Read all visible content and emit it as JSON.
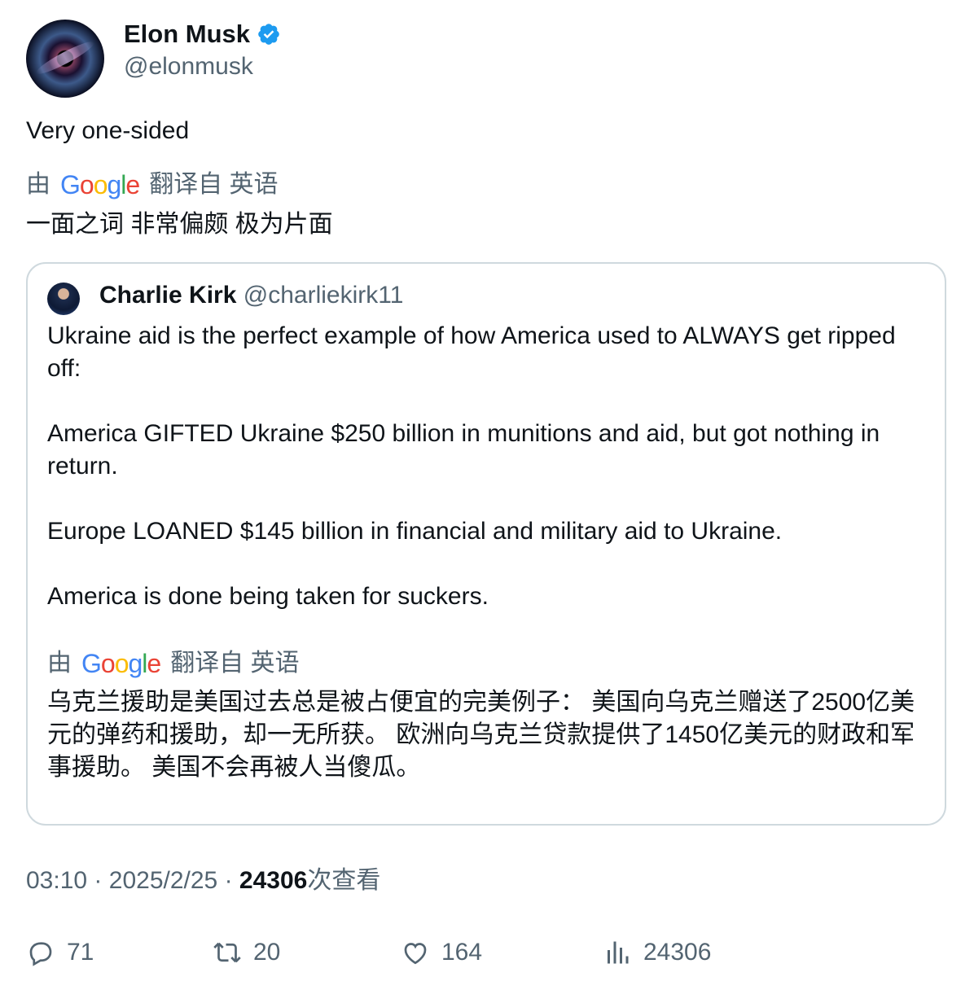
{
  "author": {
    "name": "Elon Musk",
    "handle": "@elonmusk"
  },
  "tweet": {
    "text": "Very one-sided",
    "translation_prefix": "由",
    "translation_suffix": "翻译自 英语",
    "translated_text": "一面之词 非常偏颇 极为片面"
  },
  "quoted": {
    "name": "Charlie Kirk",
    "handle": "@charliekirk11",
    "paragraphs": [
      "Ukraine aid is the perfect example of how America used to ALWAYS get ripped off:",
      "America GIFTED Ukraine $250 billion in munitions and aid, but got nothing in return.",
      "Europe LOANED $145 billion in financial and military aid to Ukraine.",
      "America is done being taken for suckers."
    ],
    "translation_prefix": "由",
    "translation_suffix": "翻译自 英语",
    "translated_text": "乌克兰援助是美国过去总是被占便宜的完美例子： 美国向乌克兰赠送了2500亿美元的弹药和援助，却一无所获。 欧洲向乌克兰贷款提供了1450亿美元的财政和军事援助。 美国不会再被人当傻瓜。"
  },
  "meta": {
    "time": "03:10",
    "sep1": "·",
    "date": "2025/2/25",
    "sep2": "·",
    "views": "24306",
    "views_label": "次查看"
  },
  "actions": {
    "replies": "71",
    "retweets": "20",
    "likes": "164",
    "views": "24306"
  },
  "colors": {
    "verified": "#1d9bf0",
    "secondary_text": "#536471",
    "border": "#cfd9de"
  },
  "icons": [
    "verified-badge-icon",
    "google-logo",
    "reply-icon",
    "retweet-icon",
    "like-icon",
    "views-icon"
  ]
}
